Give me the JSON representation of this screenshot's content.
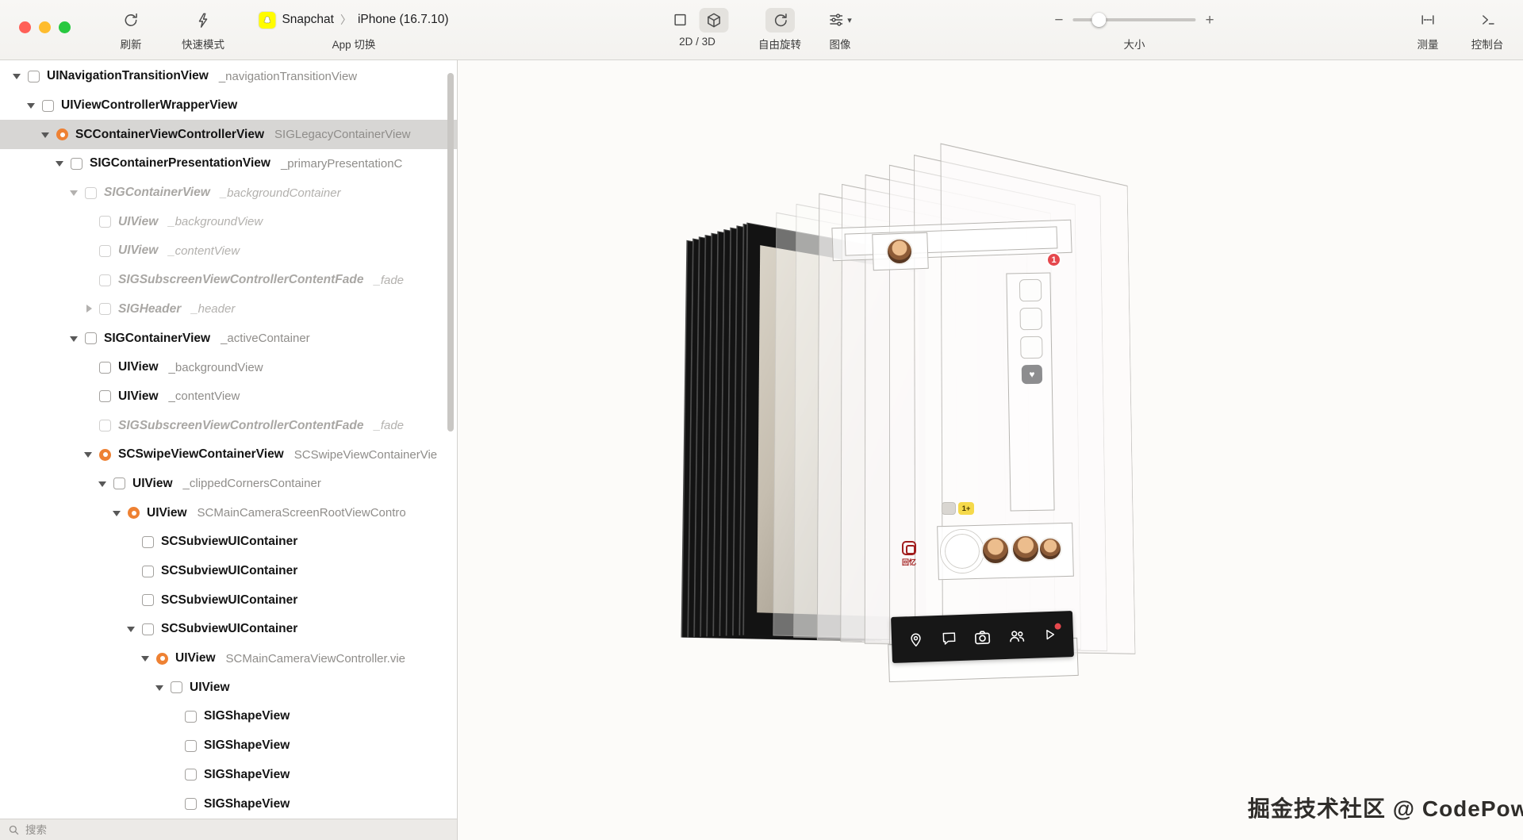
{
  "toolbar": {
    "refresh": {
      "label": "刷新"
    },
    "quick_mode": {
      "label": "快速模式"
    },
    "app_switcher": {
      "app_name": "Snapchat",
      "separator": "〉",
      "device": "iPhone (16.7.10)",
      "label": "App 切换"
    },
    "view_mode": {
      "label": "2D / 3D"
    },
    "free_rotate": {
      "label": "自由旋转"
    },
    "image": {
      "label": "图像"
    },
    "zoom": {
      "label": "大小",
      "minus": "−",
      "plus": "+",
      "knob_pct": 21
    },
    "measure": {
      "label": "测量"
    },
    "console": {
      "label": "控制台"
    }
  },
  "sidebar": {
    "search": {
      "placeholder": "搜索"
    },
    "tree": [
      {
        "title": "UINavigationTransitionView",
        "subtitle": "_navigationTransitionView",
        "level": 0,
        "disclosure": "open",
        "icon": "plain",
        "dim": false,
        "selected": false
      },
      {
        "title": "UIViewControllerWrapperView",
        "subtitle": "",
        "level": 1,
        "disclosure": "open",
        "icon": "plain",
        "dim": false,
        "selected": false
      },
      {
        "title": "SCContainerViewControllerView",
        "subtitle": "SIGLegacyContainerView",
        "level": 2,
        "disclosure": "open",
        "icon": "controller",
        "dim": false,
        "selected": true
      },
      {
        "title": "SIGContainerPresentationView",
        "subtitle": "_primaryPresentationC",
        "level": 3,
        "disclosure": "open",
        "icon": "plain",
        "dim": false,
        "selected": false
      },
      {
        "title": "SIGContainerView",
        "subtitle": "_backgroundContainer",
        "level": 4,
        "disclosure": "open",
        "icon": "plain",
        "dim": true,
        "selected": false
      },
      {
        "title": "UIView",
        "subtitle": "_backgroundView",
        "level": 5,
        "disclosure": "none",
        "icon": "plain",
        "dim": true,
        "selected": false
      },
      {
        "title": "UIView",
        "subtitle": "_contentView",
        "level": 5,
        "disclosure": "none",
        "icon": "plain",
        "dim": true,
        "selected": false
      },
      {
        "title": "SIGSubscreenViewControllerContentFade",
        "subtitle": "_fade",
        "level": 5,
        "disclosure": "none",
        "icon": "plain",
        "dim": true,
        "selected": false
      },
      {
        "title": "SIGHeader",
        "subtitle": "_header",
        "level": 5,
        "disclosure": "closed",
        "icon": "plain",
        "dim": true,
        "selected": false
      },
      {
        "title": "SIGContainerView",
        "subtitle": "_activeContainer",
        "level": 4,
        "disclosure": "open",
        "icon": "plain",
        "dim": false,
        "selected": false
      },
      {
        "title": "UIView",
        "subtitle": "_backgroundView",
        "level": 5,
        "disclosure": "none",
        "icon": "plain",
        "dim": false,
        "selected": false
      },
      {
        "title": "UIView",
        "subtitle": "_contentView",
        "level": 5,
        "disclosure": "none",
        "icon": "plain",
        "dim": false,
        "selected": false
      },
      {
        "title": "SIGSubscreenViewControllerContentFade",
        "subtitle": "_fade",
        "level": 5,
        "disclosure": "none",
        "icon": "plain",
        "dim": true,
        "selected": false
      },
      {
        "title": "SCSwipeViewContainerView",
        "subtitle": "SCSwipeViewContainerVie",
        "level": 5,
        "disclosure": "open",
        "icon": "controller",
        "dim": false,
        "selected": false
      },
      {
        "title": "UIView",
        "subtitle": "_clippedCornersContainer",
        "level": 6,
        "disclosure": "open",
        "icon": "plain",
        "dim": false,
        "selected": false
      },
      {
        "title": "UIView",
        "subtitle": "SCMainCameraScreenRootViewContro",
        "level": 7,
        "disclosure": "open",
        "icon": "controller",
        "dim": false,
        "selected": false
      },
      {
        "title": "SCSubviewUIContainer",
        "subtitle": "",
        "level": 8,
        "disclosure": "none",
        "icon": "plain",
        "dim": false,
        "selected": false
      },
      {
        "title": "SCSubviewUIContainer",
        "subtitle": "",
        "level": 8,
        "disclosure": "none",
        "icon": "plain",
        "dim": false,
        "selected": false
      },
      {
        "title": "SCSubviewUIContainer",
        "subtitle": "",
        "level": 8,
        "disclosure": "none",
        "icon": "plain",
        "dim": false,
        "selected": false
      },
      {
        "title": "SCSubviewUIContainer",
        "subtitle": "",
        "level": 8,
        "disclosure": "open",
        "icon": "plain",
        "dim": false,
        "selected": false
      },
      {
        "title": "UIView",
        "subtitle": "SCMainCameraViewController.vie",
        "level": 9,
        "disclosure": "open",
        "icon": "controller",
        "dim": false,
        "selected": false
      },
      {
        "title": "UIView",
        "subtitle": "",
        "level": 10,
        "disclosure": "open",
        "icon": "plain",
        "dim": false,
        "selected": false
      },
      {
        "title": "SIGShapeView",
        "subtitle": "",
        "level": 11,
        "disclosure": "none",
        "icon": "plain",
        "dim": false,
        "selected": false
      },
      {
        "title": "SIGShapeView",
        "subtitle": "",
        "level": 11,
        "disclosure": "none",
        "icon": "plain",
        "dim": false,
        "selected": false
      },
      {
        "title": "SIGShapeView",
        "subtitle": "",
        "level": 11,
        "disclosure": "none",
        "icon": "plain",
        "dim": false,
        "selected": false
      },
      {
        "title": "SIGShapeView",
        "subtitle": "",
        "level": 11,
        "disclosure": "none",
        "icon": "plain",
        "dim": false,
        "selected": false
      }
    ]
  },
  "canvas": {
    "badge_count": "1",
    "friends_badge": "1+",
    "memories_label": "回忆",
    "watermark": "掘金技术社区 @ CodePower"
  },
  "colors": {
    "accent_orange": "#ee8133",
    "badge_red": "#e5484d",
    "snap_yellow": "#fffc00"
  }
}
